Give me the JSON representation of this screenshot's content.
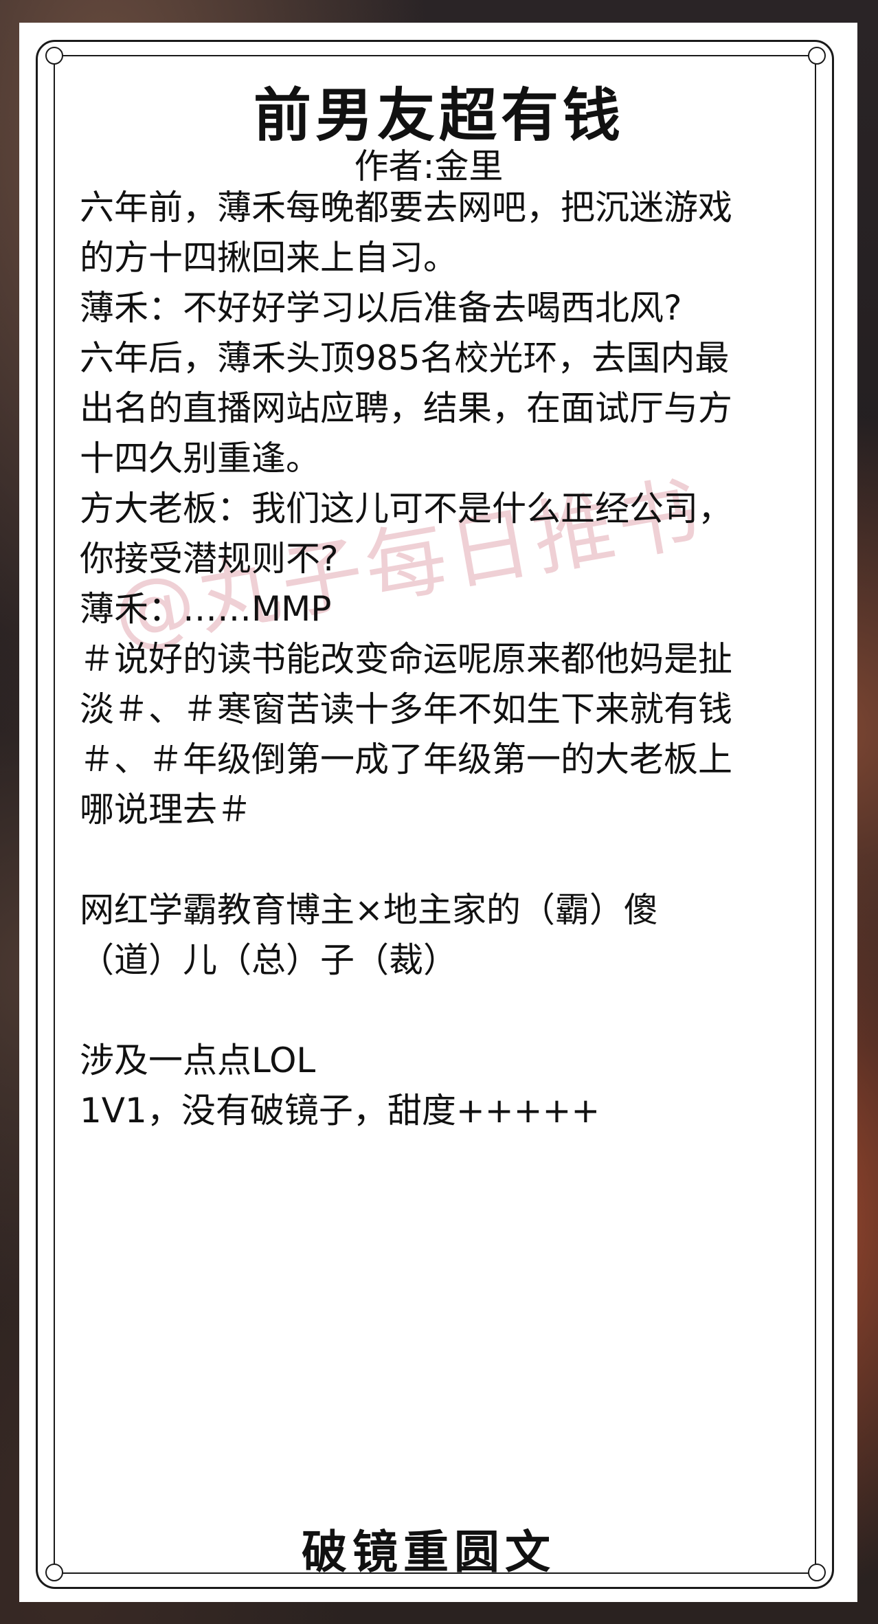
{
  "title": "前男友超有钱",
  "author": "作者:金里",
  "content_lines": [
    "六年前，薄禾每晚都要去网吧，把沉迷游戏",
    "的方十四揪回来上自习。",
    "薄禾：不好好学习以后准备去喝西北风?",
    "六年后，薄禾头顶985名校光环，去国内最",
    "出名的直播网站应聘，结果，在面试厅与方",
    "十四久别重逢。",
    "方大老板：我们这儿可不是什么正经公司，",
    "你接受潜规则不?",
    "薄禾：……MMP",
    "＃说好的读书能改变命运呢原来都他妈是扯",
    "淡＃、＃寒窗苦读十多年不如生下来就有钱",
    "＃、＃年级倒第一成了年级第一的大老板上",
    "哪说理去＃",
    "",
    "网红学霸教育博主×地主家的（霸）傻",
    "（道）儿（总）子（裁）",
    "",
    "涉及一点点LOL",
    "1V1，没有破镜子，甜度+++++"
  ],
  "watermark": "@丸子每日推书",
  "footer": "破镜重圆文"
}
